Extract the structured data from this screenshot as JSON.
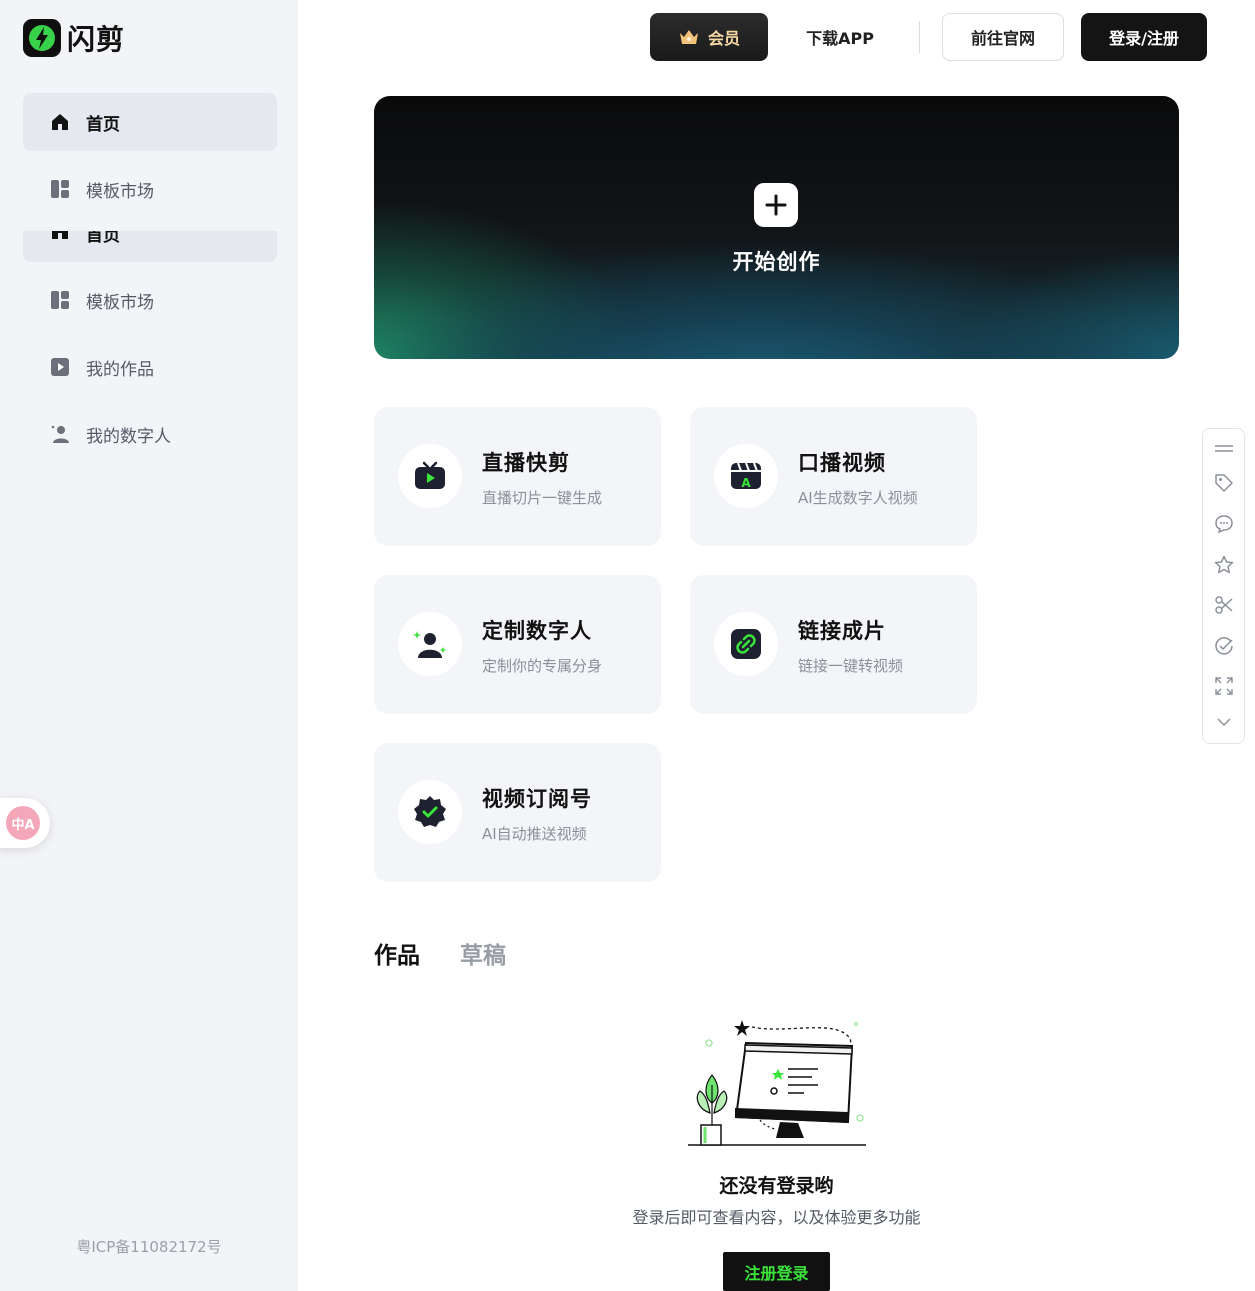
{
  "brand": {
    "name": "闪剪"
  },
  "sidebar": {
    "items": [
      {
        "label": "首页",
        "icon": "home-icon",
        "active": true
      },
      {
        "label": "模板市场",
        "icon": "template-icon",
        "active": false
      },
      {
        "label": "首页",
        "icon": "home-icon",
        "active": true
      },
      {
        "label": "模板市场",
        "icon": "template-icon",
        "active": false
      },
      {
        "label": "我的作品",
        "icon": "play-square-icon",
        "active": false
      },
      {
        "label": "我的数字人",
        "icon": "user-sparkle-icon",
        "active": false
      }
    ],
    "icp": "粤ICP备11082172号",
    "translate_label": "中A"
  },
  "header": {
    "vip": "会员",
    "download": "下载APP",
    "official": "前往官网",
    "login": "登录/注册"
  },
  "hero": {
    "label": "开始创作"
  },
  "features": [
    {
      "title": "直播快剪",
      "subtitle": "直播切片一键生成",
      "icon": "tv-play-icon"
    },
    {
      "title": "口播视频",
      "subtitle": "AI生成数字人视频",
      "icon": "clapper-icon"
    },
    {
      "title": "定制数字人",
      "subtitle": "定制你的专属分身",
      "icon": "user-sparkle-icon"
    },
    {
      "title": "链接成片",
      "subtitle": "链接一键转视频",
      "icon": "link-icon"
    },
    {
      "title": "视频订阅号",
      "subtitle": "AI自动推送视频",
      "icon": "verified-badge-icon"
    }
  ],
  "tabs": {
    "works": "作品",
    "drafts": "草稿"
  },
  "empty": {
    "title": "还没有登录哟",
    "subtitle": "登录后即可查看内容，以及体验更多功能",
    "button": "注册登录"
  },
  "toolstrip": [
    "menu-icon",
    "tag-icon",
    "comment-icon",
    "star-icon",
    "scissors-icon",
    "check-circle-icon",
    "expand-icon",
    "chevron-down-icon"
  ],
  "colors": {
    "accent_green": "#3be43b",
    "sidebar_bg": "#f3f4f7",
    "card_bg": "#f4f5f8",
    "dark": "#141414"
  }
}
